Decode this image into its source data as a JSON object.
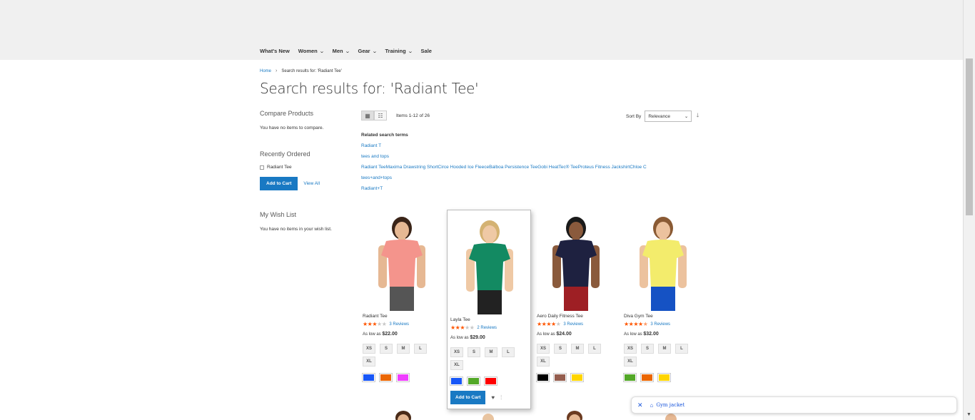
{
  "nav": [
    "What's New",
    "Women",
    "Men",
    "Gear",
    "Training",
    "Sale"
  ],
  "breadcrumb": {
    "home": "Home",
    "separator": "›",
    "current": "Search results for: 'Radiant Tee'"
  },
  "page_title": "Search results for: 'Radiant Tee'",
  "sidebar": {
    "compare_title": "Compare Products",
    "compare_text": "You have no items to compare.",
    "recent_title": "Recently Ordered",
    "recent_item": "Radiant Tee",
    "add_to_cart": "Add to Cart",
    "view_all": "View All",
    "wishlist_title": "My Wish List",
    "wishlist_text": "You have no items in your wish list."
  },
  "toolbar": {
    "amount": "Items 1-12 of 26",
    "sort_label": "Sort By",
    "sort_value": "Relevance"
  },
  "related": {
    "title": "Related search terms",
    "links": [
      "Radiant T",
      "tees and tops",
      "Radiant TeeMaxima Drawstring ShortCirce Hooded Ice FleeceBalboa Persistence TeeGobi HeatTec® TeeProteus Fitness JackshirtChloe C",
      "tees+and+tops",
      "Radiant+T"
    ]
  },
  "products": [
    {
      "name": "Radiant Tee",
      "rating": 3,
      "reviews": "3 Reviews",
      "price_label": "As low as",
      "price": "$22.00",
      "sizes": [
        "XS",
        "S",
        "M",
        "L",
        "XL"
      ],
      "colors": [
        "#1857f7",
        "#eb6703",
        "#ef3dff"
      ],
      "shirt": "#f4948c",
      "skin": "#e6b893",
      "pants": "#555555",
      "hair": "#3a2418"
    },
    {
      "name": "Layla Tee",
      "rating": 3,
      "reviews": "2 Reviews",
      "price_label": "As low as",
      "price": "$29.00",
      "sizes": [
        "XS",
        "S",
        "M",
        "L",
        "XL"
      ],
      "colors": [
        "#1857f7",
        "#53a828",
        "#ff0000"
      ],
      "shirt": "#138a62",
      "skin": "#efc9a5",
      "pants": "#222222",
      "hair": "#d4b272"
    },
    {
      "name": "Aero Daily Fitness Tee",
      "rating": 4,
      "reviews": "3 Reviews",
      "price_label": "As low as",
      "price": "$24.00",
      "sizes": [
        "XS",
        "S",
        "M",
        "L",
        "XL"
      ],
      "colors": [
        "#000000",
        "#945d4e",
        "#ffd500"
      ],
      "shirt": "#1e2140",
      "skin": "#8a5a3c",
      "pants": "#9e1f24",
      "hair": "#1a1a1a"
    },
    {
      "name": "Diva Gym Tee",
      "rating": 4.5,
      "reviews": "3 Reviews",
      "price_label": "As low as",
      "price": "$32.00",
      "sizes": [
        "XS",
        "S",
        "M",
        "L",
        "XL"
      ],
      "colors": [
        "#53a828",
        "#eb6703",
        "#ffd500"
      ],
      "shirt": "#f3ec6c",
      "skin": "#ecc29e",
      "pants": "#1552c4",
      "hair": "#8a5a34"
    }
  ],
  "hover_actions": {
    "add_to_cart": "Add to Cart",
    "wishlist_icon": "heart-icon",
    "compare_icon": "compare-icon"
  },
  "chip": {
    "label": "Gym jacket"
  }
}
